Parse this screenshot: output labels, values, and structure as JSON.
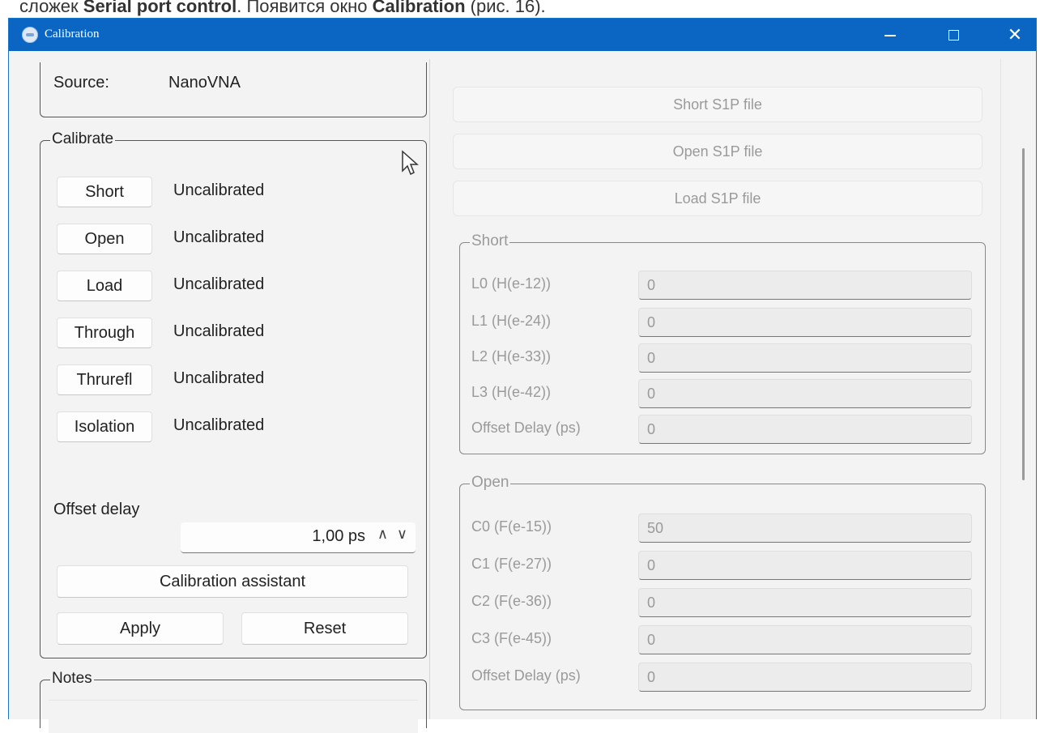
{
  "caption": {
    "text_a": "сложек ",
    "bold_a": "Serial port control",
    "text_b": ". Появится окно ",
    "bold_b": "Calibration",
    "text_c": " (рис. 16)."
  },
  "window": {
    "title": "Calibration",
    "minimize": "minimize",
    "maximize": "maximize",
    "close": "✕"
  },
  "source": {
    "label": "Source:",
    "value": "NanoVNA"
  },
  "calibrate": {
    "title": "Calibrate",
    "rows": [
      {
        "button": "Short",
        "status": "Uncalibrated"
      },
      {
        "button": "Open",
        "status": "Uncalibrated"
      },
      {
        "button": "Load",
        "status": "Uncalibrated"
      },
      {
        "button": "Through",
        "status": "Uncalibrated"
      },
      {
        "button": "Thrurefl",
        "status": "Uncalibrated"
      },
      {
        "button": "Isolation",
        "status": "Uncalibrated"
      }
    ],
    "offset_delay_label": "Offset delay",
    "offset_delay_value": "1,00 ps",
    "spin_up": "∧",
    "spin_down": "∨",
    "assistant_button": "Calibration assistant",
    "apply_button": "Apply",
    "reset_button": "Reset"
  },
  "notes": {
    "title": "Notes"
  },
  "files": {
    "short_file": "Short S1P file",
    "open_file": "Open S1P file",
    "load_file": "Load S1P file"
  },
  "short_group": {
    "title": "Short",
    "params": [
      {
        "label": "L0 (H(e-12))",
        "value": "0"
      },
      {
        "label": "L1 (H(e-24))",
        "value": "0"
      },
      {
        "label": "L2 (H(e-33))",
        "value": "0"
      },
      {
        "label": "L3 (H(e-42))",
        "value": "0"
      },
      {
        "label": "Offset Delay (ps)",
        "value": "0"
      }
    ]
  },
  "open_group": {
    "title": "Open",
    "params": [
      {
        "label": "C0 (F(e-15))",
        "value": "50"
      },
      {
        "label": "C1 (F(e-27))",
        "value": "0"
      },
      {
        "label": "C2 (F(e-36))",
        "value": "0"
      },
      {
        "label": "C3 (F(e-45))",
        "value": "0"
      },
      {
        "label": "Offset Delay (ps)",
        "value": "0"
      }
    ]
  },
  "colors": {
    "titlebar": "#0b66c3",
    "client": "#f3f3f3"
  }
}
